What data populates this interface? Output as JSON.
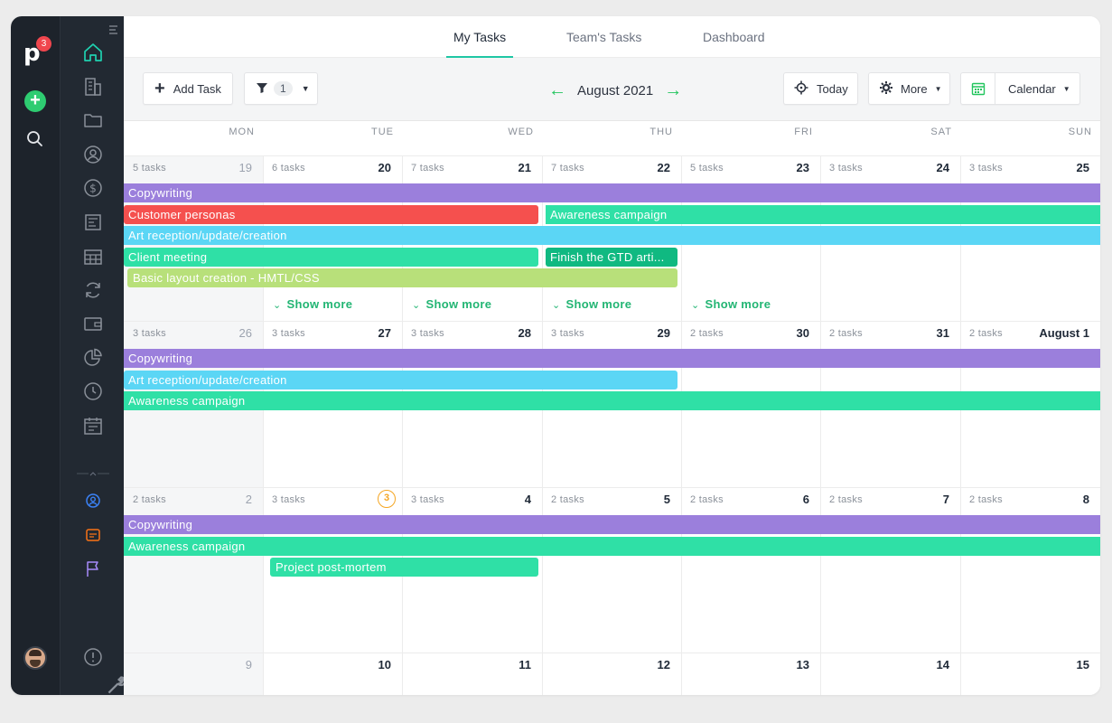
{
  "app": {
    "logo_letter": "p",
    "notification_count": "3"
  },
  "tabs": [
    {
      "label": "My Tasks",
      "active": true
    },
    {
      "label": "Team's Tasks",
      "active": false
    },
    {
      "label": "Dashboard",
      "active": false
    }
  ],
  "toolbar": {
    "add_task_label": "Add Task",
    "filter_count": "1",
    "month_label": "August 2021",
    "today_label": "Today",
    "more_label": "More",
    "view_label": "Calendar"
  },
  "weekdays": [
    "MON",
    "TUE",
    "WED",
    "THU",
    "FRI",
    "SAT",
    "SUN"
  ],
  "weeks": [
    {
      "days": [
        {
          "count": "5 tasks",
          "num": "19",
          "dim": true
        },
        {
          "count": "6 tasks",
          "num": "20"
        },
        {
          "count": "7 tasks",
          "num": "21"
        },
        {
          "count": "7 tasks",
          "num": "22"
        },
        {
          "count": "5 tasks",
          "num": "23"
        },
        {
          "count": "3 tasks",
          "num": "24"
        },
        {
          "count": "3 tasks",
          "num": "25"
        }
      ],
      "bars": [
        {
          "label": "Copywriting",
          "color": "#9b7fdc",
          "start": 0,
          "span": 7,
          "row": 0
        },
        {
          "label": "Customer personas",
          "color": "#f5504e",
          "start": 0,
          "span": 3,
          "row": 1,
          "rounded": true
        },
        {
          "label": "Awareness campaign",
          "color": "#2fe0a6",
          "start": 3,
          "span": 4,
          "row": 1
        },
        {
          "label": "Art reception/update/creation",
          "color": "#5bd6f5",
          "start": 0,
          "span": 7,
          "row": 2
        },
        {
          "label": "Client meeting",
          "color": "#2fe0a6",
          "start": 0,
          "span": 3,
          "row": 3,
          "rounded": true
        },
        {
          "label": "Finish the GTD arti...",
          "color": "#10b981",
          "start": 3,
          "span": 1,
          "row": 3,
          "rounded": true
        },
        {
          "label": "Basic layout creation - HMTL/CSS",
          "color": "#b8e07a",
          "start": 0,
          "span": 4,
          "row": 4,
          "rounded": true,
          "inset": true
        }
      ],
      "show_more": [
        {
          "label": "Show more",
          "col": 1
        },
        {
          "label": "Show more",
          "col": 2
        },
        {
          "label": "Show more",
          "col": 3
        },
        {
          "label": "Show more",
          "col": 4
        }
      ]
    },
    {
      "days": [
        {
          "count": "3 tasks",
          "num": "26",
          "dim": true
        },
        {
          "count": "3 tasks",
          "num": "27"
        },
        {
          "count": "3 tasks",
          "num": "28"
        },
        {
          "count": "3 tasks",
          "num": "29"
        },
        {
          "count": "2 tasks",
          "num": "30"
        },
        {
          "count": "2 tasks",
          "num": "31"
        },
        {
          "count": "2 tasks",
          "num": "August 1"
        }
      ],
      "bars": [
        {
          "label": "Copywriting",
          "color": "#9b7fdc",
          "start": 0,
          "span": 7,
          "row": 0
        },
        {
          "label": "Art reception/update/creation",
          "color": "#5bd6f5",
          "start": 0,
          "span": 4,
          "row": 1,
          "rounded": true
        },
        {
          "label": "Awareness campaign",
          "color": "#2fe0a6",
          "start": 0,
          "span": 7,
          "row": 2
        }
      ],
      "show_more": []
    },
    {
      "days": [
        {
          "count": "2 tasks",
          "num": "2",
          "dim": true
        },
        {
          "count": "3 tasks",
          "num": "3",
          "today": true
        },
        {
          "count": "3 tasks",
          "num": "4"
        },
        {
          "count": "2 tasks",
          "num": "5"
        },
        {
          "count": "2 tasks",
          "num": "6"
        },
        {
          "count": "2 tasks",
          "num": "7"
        },
        {
          "count": "2 tasks",
          "num": "8"
        }
      ],
      "bars": [
        {
          "label": "Copywriting",
          "color": "#9b7fdc",
          "start": 0,
          "span": 7,
          "row": 0
        },
        {
          "label": "Awareness campaign",
          "color": "#2fe0a6",
          "start": 0,
          "span": 7,
          "row": 1
        },
        {
          "label": "Project post-mortem",
          "color": "#2fe0a6",
          "start": 1,
          "span": 2,
          "row": 2,
          "rounded": true,
          "inset": true
        }
      ],
      "show_more": []
    },
    {
      "days": [
        {
          "count": "",
          "num": "9",
          "dim": true
        },
        {
          "count": "",
          "num": "10"
        },
        {
          "count": "",
          "num": "11"
        },
        {
          "count": "",
          "num": "12"
        },
        {
          "count": "",
          "num": "13"
        },
        {
          "count": "",
          "num": "14"
        },
        {
          "count": "",
          "num": "15"
        }
      ],
      "bars": [],
      "show_more": []
    }
  ]
}
